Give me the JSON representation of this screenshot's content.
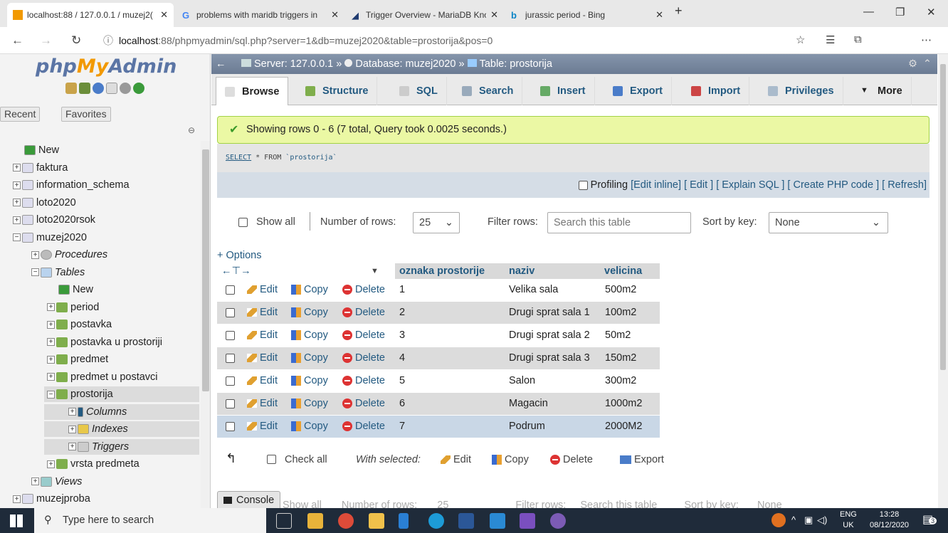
{
  "browser": {
    "tabs": [
      {
        "title": "localhost:88 / 127.0.0.1 / muzej2(",
        "active": true
      },
      {
        "title": "problems with maridb triggers in",
        "active": false
      },
      {
        "title": "Trigger Overview - MariaDB Kno",
        "active": false
      },
      {
        "title": "jurassic period - Bing",
        "active": false
      }
    ],
    "new_tab": "+",
    "url_host": "localhost",
    "url_rest": ":88/phpmyadmin/sql.php?server=1&db=muzej2020&table=prostorija&pos=0"
  },
  "sidebar": {
    "logo_php": "php",
    "logo_my": "My",
    "logo_admin": "Admin",
    "recent": "Recent",
    "favorites": "Favorites",
    "tree": [
      {
        "label": "New",
        "level": 0
      },
      {
        "label": "faktura",
        "level": 0
      },
      {
        "label": "information_schema",
        "level": 0
      },
      {
        "label": "loto2020",
        "level": 0
      },
      {
        "label": "loto2020rsok",
        "level": 0
      },
      {
        "label": "muzej2020",
        "level": 0
      },
      {
        "label": "Procedures",
        "level": 1
      },
      {
        "label": "Tables",
        "level": 1
      },
      {
        "label": "New",
        "level": 2
      },
      {
        "label": "period",
        "level": 2
      },
      {
        "label": "postavka",
        "level": 2
      },
      {
        "label": "postavka u prostoriji",
        "level": 2
      },
      {
        "label": "predmet",
        "level": 2
      },
      {
        "label": "predmet u postavci",
        "level": 2
      },
      {
        "label": "prostorija",
        "level": 2
      },
      {
        "label": "Columns",
        "level": 3
      },
      {
        "label": "Indexes",
        "level": 3
      },
      {
        "label": "Triggers",
        "level": 3
      },
      {
        "label": "vrsta predmeta",
        "level": 2
      },
      {
        "label": "Views",
        "level": 1
      },
      {
        "label": "muzejproba",
        "level": 0
      }
    ]
  },
  "breadcrumb": {
    "server": "Server: 127.0.0.1",
    "database": "Database: muzej2020",
    "table": "Table: prostorija"
  },
  "tabs": [
    "Browse",
    "Structure",
    "SQL",
    "Search",
    "Insert",
    "Export",
    "Import",
    "Privileges",
    "More"
  ],
  "message": "Showing rows 0 - 6 (7 total, Query took 0.0025 seconds.)",
  "sql": {
    "select": "SELECT",
    "rest": " * FROM ",
    "table": "`prostorija`"
  },
  "profiling": {
    "label": "Profiling",
    "links": [
      "[Edit inline]",
      "[ Edit ]",
      "[ Explain SQL ]",
      "[ Create PHP code ]",
      "[ Refresh]"
    ]
  },
  "nav": {
    "show_all": "Show all",
    "rows_label": "Number of rows:",
    "rows_value": "25",
    "filter_label": "Filter rows:",
    "filter_placeholder": "Search this table",
    "sort_label": "Sort by key:",
    "sort_value": "None"
  },
  "options": "+ Options",
  "columns": [
    "oznaka prostorije",
    "naziv",
    "velicina"
  ],
  "actions": {
    "edit": "Edit",
    "copy": "Copy",
    "delete": "Delete"
  },
  "rows": [
    {
      "oznaka": "1",
      "naziv": "Velika sala",
      "velicina": "500m2"
    },
    {
      "oznaka": "2",
      "naziv": "Drugi sprat sala 1",
      "velicina": "100m2"
    },
    {
      "oznaka": "3",
      "naziv": "Drugi sprat sala 2",
      "velicina": "50m2"
    },
    {
      "oznaka": "4",
      "naziv": "Drugi sprat sala 3",
      "velicina": "150m2"
    },
    {
      "oznaka": "5",
      "naziv": "Salon",
      "velicina": "300m2"
    },
    {
      "oznaka": "6",
      "naziv": "Magacin",
      "velicina": "1000m2"
    },
    {
      "oznaka": "7",
      "naziv": "Podrum",
      "velicina": "2000M2"
    }
  ],
  "bottom": {
    "check_all": "Check all",
    "with_selected": "With selected:",
    "edit": "Edit",
    "copy": "Copy",
    "delete": "Delete",
    "export": "Export"
  },
  "console": "Console",
  "taskbar": {
    "search_placeholder": "Type here to search",
    "lang1": "ENG",
    "lang2": "UK",
    "time": "13:28",
    "date": "08/12/2020",
    "notif_count": "3"
  }
}
